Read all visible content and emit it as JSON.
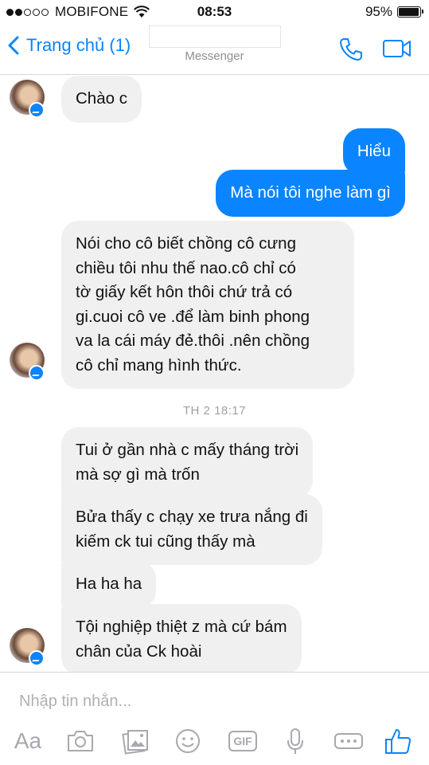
{
  "status_bar": {
    "signal_dots": 5,
    "signal_filled": 2,
    "carrier": "MOBIFONE",
    "time": "08:53",
    "battery_text": "95%",
    "battery_level": 0.95
  },
  "nav": {
    "back_label": "Trang chủ (1)",
    "subtitle": "Messenger",
    "accent_color": "#0a84ff"
  },
  "messages": [
    {
      "side": "in",
      "text": "Chào c"
    },
    {
      "side": "out",
      "text": "Hiểu"
    },
    {
      "side": "out",
      "text": "Mà nói tôi nghe làm gì"
    },
    {
      "side": "in",
      "text": "Nói cho cô biết chồng cô cưng\nchiều tôi nhu thế nao.cô chỉ có\ntờ giấy kết hôn thôi chứ trả có\ngi.cuoi cô ve .để làm binh phong\nva la cái máy đẻ.thôi .nên chồng\ncô chỉ mang hình thức."
    },
    {
      "side": "in",
      "text": "Tui ở gần nhà c mấy tháng trời\nmà sợ gì mà trốn"
    },
    {
      "side": "in",
      "text": "Bửa thấy c chạy xe trưa nắng đi\nkiếm ck tui cũng thấy mà"
    },
    {
      "side": "in",
      "text": "Ha ha ha"
    },
    {
      "side": "in",
      "text": "Tội nghiệp thiệt z mà cứ bám\nchân của Ck hoài"
    }
  ],
  "timestamp": "TH 2 18:17",
  "composer": {
    "placeholder": "Nhập tin nhắn...",
    "aa_label": "Aa",
    "gif_label": "GIF",
    "tools": [
      "text-format-icon",
      "camera-icon",
      "photos-icon",
      "emoji-icon",
      "gif-icon",
      "microphone-icon",
      "more-icon",
      "thumbs-up-icon"
    ]
  }
}
